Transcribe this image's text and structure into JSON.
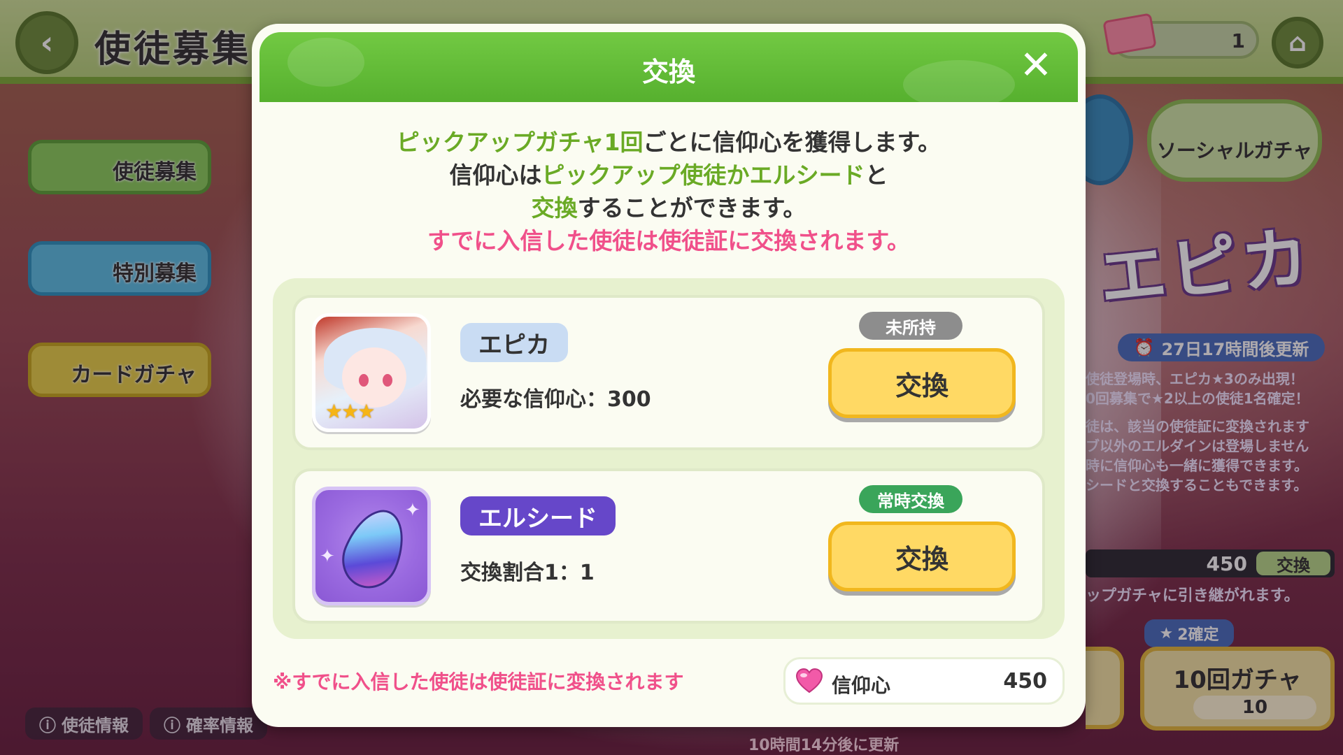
{
  "background": {
    "screen_title": "使徒募集",
    "ticket_count": "1",
    "side_menu": [
      "使徒募集",
      "特別募集",
      "カードガチャ"
    ],
    "social_gacha_label": "ソーシャルガチャ",
    "banner_logo": "エピカ",
    "timer": "27日17時間後更新",
    "info_lines": [
      "使徒登場時、エピカ★3のみ出現！",
      "0回募集で★2以上の使徒1名確定！",
      "徒は、該当の使徒証に変換されます",
      "ブ以外のエルダインは登場しません",
      "時に信仰心も一緒に獲得できます。",
      "シードと交換することもできます。"
    ],
    "faith_value": "450",
    "faith_exchange_label": "交換",
    "carry_over_text": "ップガチャに引き継がれます。",
    "gacha10_badge": "2確定",
    "gacha10_label": "10回ガチャ",
    "gacha10_count": "10",
    "bottom_buttons": [
      "使徒情報",
      "確率情報"
    ],
    "update_text": "10時間14分後に更新"
  },
  "modal": {
    "title": "交換",
    "description": {
      "line1_green": "ピックアップガチャ1回",
      "line1_rest": "ごとに信仰心を獲得します。",
      "line2_pre": "信仰心は",
      "line2_green": "ピックアップ使徒かエルシード",
      "line2_post": "と",
      "line3_green": "交換",
      "line3_rest": "することができます。",
      "line4_pink": "すでに入信した使徒は使徒証に交換されます。"
    },
    "items": [
      {
        "name": "エピカ",
        "sub": "必要な信仰心：300",
        "status": "未所持",
        "button": "交換",
        "rarity_stars": "★★★"
      },
      {
        "name": "エルシード",
        "sub": "交換割合1：1",
        "status": "常時交換",
        "button": "交換"
      }
    ],
    "footnote": "※すでに入信した使徒は使徒証に変換されます",
    "balance": {
      "label": "信仰心",
      "value": "450"
    }
  },
  "icons": {
    "back": "back-arrow-icon",
    "home": "home-icon",
    "close": "close-icon",
    "heart": "heart-icon",
    "clock": "clock-icon",
    "info": "info-icon",
    "ticket": "ticket-icon",
    "star": "star-icon"
  },
  "colors": {
    "header_green": "#56b02e",
    "highlight_green": "#6aaa25",
    "highlight_pink": "#f0508a",
    "button_yellow": "#ffd964",
    "status_gray": "#8d8d8d",
    "status_green": "#3aa55a",
    "elseed_purple": "#6647c9"
  }
}
